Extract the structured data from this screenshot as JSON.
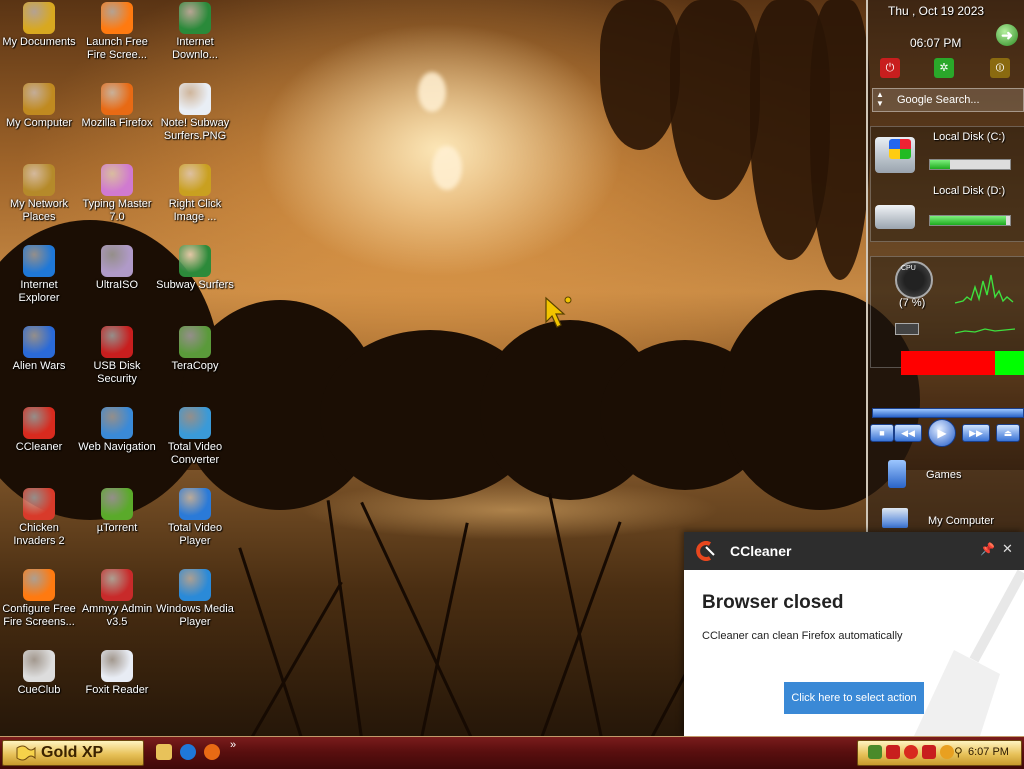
{
  "desktop": {
    "icons": [
      {
        "label": "My Documents",
        "icon": "folder-documents-icon",
        "color": "#d8a820"
      },
      {
        "label": "Launch Free Fire Scree...",
        "icon": "fire-icon",
        "color": "#ff7a10"
      },
      {
        "label": "Internet Downlo...",
        "icon": "download-globe-icon",
        "color": "#2a8a3a"
      },
      {
        "label": "My Computer",
        "icon": "computer-icon",
        "color": "#c08a20"
      },
      {
        "label": "Mozilla Firefox",
        "icon": "firefox-icon",
        "color": "#e86a14"
      },
      {
        "label": "Note! Subway Surfers.PNG",
        "icon": "image-file-icon",
        "color": "#e9eef5"
      },
      {
        "label": "My Network Places",
        "icon": "network-icon",
        "color": "#b58a2a"
      },
      {
        "label": "Typing Master 7.0",
        "icon": "typing-master-icon",
        "color": "#d07ad0"
      },
      {
        "label": "Right Click Image ...",
        "icon": "gear-icon",
        "color": "#c9a020"
      },
      {
        "label": "Internet Explorer",
        "icon": "ie-icon",
        "color": "#1f78d8"
      },
      {
        "label": "UltraISO",
        "icon": "disc-icon",
        "color": "#b09ac8"
      },
      {
        "label": "Subway Surfers",
        "icon": "game-icon",
        "color": "#2c8a3a"
      },
      {
        "label": "Alien Wars",
        "icon": "alien-wars-icon",
        "color": "#2a6ad8"
      },
      {
        "label": "USB Disk Security",
        "icon": "shield-icon",
        "color": "#c81e1e"
      },
      {
        "label": "TeraCopy",
        "icon": "teracopy-icon",
        "color": "#5a9a3a"
      },
      {
        "label": "CCleaner",
        "icon": "ccleaner-icon",
        "color": "#d82a1e"
      },
      {
        "label": "Web Navigation",
        "icon": "globe-icon",
        "color": "#3a8ad8"
      },
      {
        "label": "Total Video Converter",
        "icon": "video-converter-icon",
        "color": "#3a9ad8"
      },
      {
        "label": "Chicken Invaders 2",
        "icon": "chicken-icon",
        "color": "#d83a2a"
      },
      {
        "label": "µTorrent",
        "icon": "utorrent-icon",
        "color": "#5aaa2a"
      },
      {
        "label": "Total Video Player",
        "icon": "video-player-icon",
        "color": "#2a7ad8"
      },
      {
        "label": "Configure Free Fire Screens...",
        "icon": "fire-icon",
        "color": "#ff7a10"
      },
      {
        "label": "Ammyy Admin v3.5",
        "icon": "ammyy-icon",
        "color": "#c82a2a"
      },
      {
        "label": "Windows Media Player",
        "icon": "media-player-icon",
        "color": "#2a8ad8"
      },
      {
        "label": "CueClub",
        "icon": "cueclub-icon",
        "color": "#dddddd"
      },
      {
        "label": "Foxit Reader",
        "icon": "foxit-icon",
        "color": "#e8ecf4"
      }
    ]
  },
  "sidebar": {
    "date": "Thu , Oct 19 2023",
    "time": "06:07 PM",
    "search_placeholder": "Google Search...",
    "disk_c_label": "Local Disk (C:)",
    "disk_c_used": 0.25,
    "disk_d_label": "Local Disk (D:)",
    "disk_d_used": 0.95,
    "cpu_label": "(7 %)",
    "cpu_icon": "CPU",
    "games_label": "Games",
    "my_computer_label": "My Computer"
  },
  "toast": {
    "app": "CCleaner",
    "heading": "Browser closed",
    "message": "CCleaner can clean Firefox automatically",
    "action": "Click here to select action"
  },
  "taskbar": {
    "start_label": "Gold XP",
    "overflow": "»",
    "clock": "6:07 PM"
  },
  "colors": {
    "taskbar": "#5a0f0f",
    "start_gold": "#e8c25a",
    "toast_header": "#2d2d2d",
    "toast_button": "#3a89d6",
    "cpu_red": "#ff0000",
    "cpu_green": "#00ff00"
  }
}
